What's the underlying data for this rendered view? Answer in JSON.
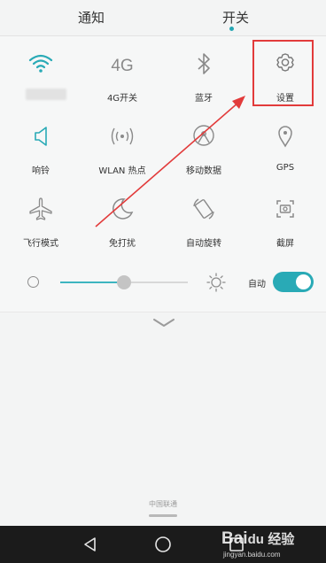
{
  "tabs": {
    "notify": "通知",
    "switch": "开关"
  },
  "toggles": {
    "wifi": {
      "label": "",
      "icon": "wifi-icon",
      "active": true
    },
    "g4": {
      "text": "4G",
      "label": "4G开关",
      "icon": "4g-icon"
    },
    "bluetooth": {
      "label": "蓝牙",
      "icon": "bluetooth-icon"
    },
    "settings": {
      "label": "设置",
      "icon": "gear-icon"
    },
    "ringer": {
      "label": "响铃",
      "icon": "speaker-icon",
      "active": true
    },
    "hotspot": {
      "label": "WLAN 热点",
      "icon": "hotspot-icon"
    },
    "mobile_data": {
      "label": "移动数据",
      "icon": "mobile-data-icon"
    },
    "gps": {
      "label": "GPS",
      "icon": "location-pin-icon"
    },
    "airplane": {
      "label": "飞行模式",
      "icon": "airplane-icon"
    },
    "dnd": {
      "label": "免打扰",
      "icon": "moon-icon"
    },
    "rotate": {
      "label": "自动旋转",
      "icon": "rotate-icon"
    },
    "screenshot": {
      "label": "截屏",
      "icon": "screenshot-icon"
    }
  },
  "brightness": {
    "value": 0.5,
    "auto_label": "自动",
    "auto_enabled": true
  },
  "carrier": "中国联通",
  "watermark": {
    "brand": "Bai",
    "paw": "du",
    "site": "经验",
    "url": "jingyan.baidu.com"
  },
  "colors": {
    "accent": "#29aab6",
    "annotation": "#e23b3b"
  }
}
